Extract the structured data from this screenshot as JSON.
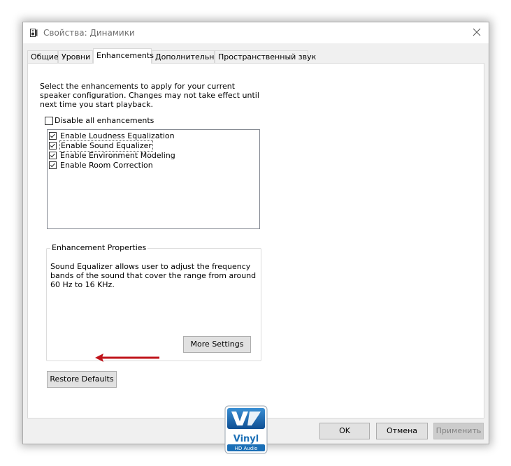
{
  "window": {
    "title": "Свойства: Динамики"
  },
  "tabs": [
    {
      "label": "Общие"
    },
    {
      "label": "Уровни"
    },
    {
      "label": "Enhancements"
    },
    {
      "label": "Дополнительно"
    },
    {
      "label": "Пространственный звук"
    }
  ],
  "active_tab": "Enhancements",
  "description": "Select the enhancements to apply for your current speaker configuration. Changes may not take effect until next time you start playback.",
  "disable_all": {
    "label": "Disable all enhancements",
    "checked": false
  },
  "enhancements": [
    {
      "label": "Enable Loudness Equalization",
      "checked": true
    },
    {
      "label": "Enable Sound Equalizer",
      "checked": true,
      "selected": true
    },
    {
      "label": "Enable Environment Modeling",
      "checked": true
    },
    {
      "label": "Enable Room Correction",
      "checked": true
    }
  ],
  "properties": {
    "title": "Enhancement Properties",
    "text": "Sound Equalizer allows user to adjust the frequency bands of the sound that cover the range from around 60 Hz to 16 KHz.",
    "more_settings_label": "More Settings"
  },
  "restore_defaults_label": "Restore Defaults",
  "logo": {
    "brand": "VIA",
    "product": "Vinyl",
    "subtitle": "HD Audio"
  },
  "footer": {
    "ok_label": "OK",
    "cancel_label": "Отмена",
    "apply_label": "Применить",
    "apply_enabled": false
  },
  "colors": {
    "accent_arrow": "#c0141b",
    "logo_blue": "#1b6fb6"
  }
}
